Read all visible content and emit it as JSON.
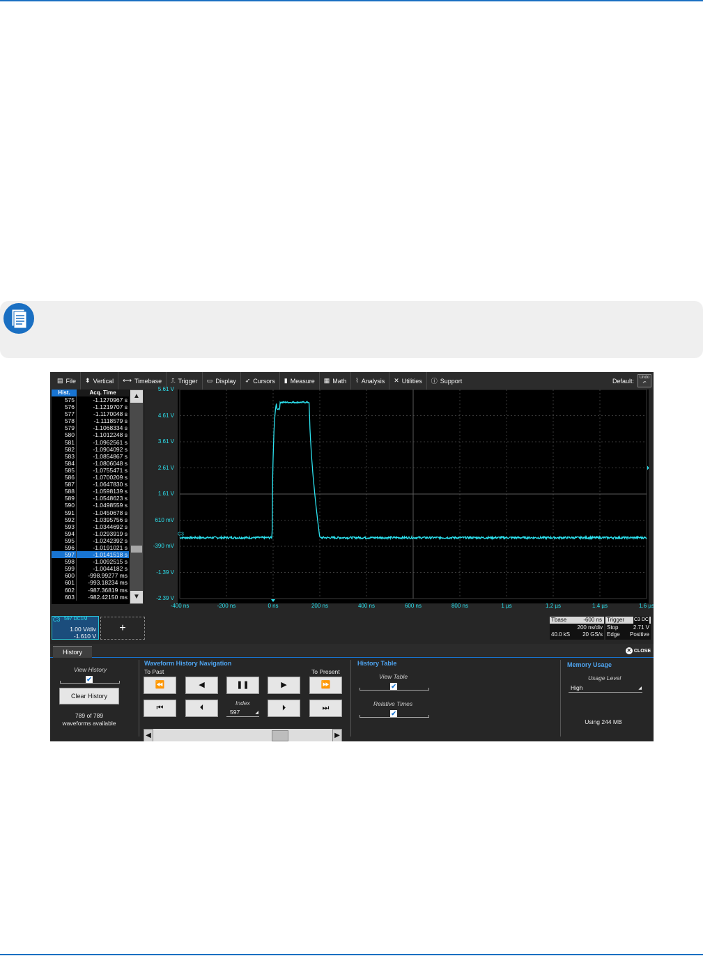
{
  "menu": {
    "items": [
      {
        "label": "File",
        "icon": "clipboard-icon"
      },
      {
        "label": "Vertical",
        "icon": "vertical-arrows-icon"
      },
      {
        "label": "Timebase",
        "icon": "horizontal-arrows-icon"
      },
      {
        "label": "Trigger",
        "icon": "trigger-icon"
      },
      {
        "label": "Display",
        "icon": "display-icon"
      },
      {
        "label": "Cursors",
        "icon": "cursor-icon"
      },
      {
        "label": "Measure",
        "icon": "ruler-icon"
      },
      {
        "label": "Math",
        "icon": "calculator-icon"
      },
      {
        "label": "Analysis",
        "icon": "chart-icon"
      },
      {
        "label": "Utilities",
        "icon": "tools-icon"
      },
      {
        "label": "Support",
        "icon": "info-icon"
      }
    ],
    "default_label": "Default:",
    "undo_label": "Undo"
  },
  "history_table": {
    "col_index": "Hist.",
    "col_time": "Acq. Time",
    "selected_index": "597",
    "rows": [
      {
        "idx": "575",
        "time": "-1.1270967 s"
      },
      {
        "idx": "576",
        "time": "-1.1219707 s"
      },
      {
        "idx": "577",
        "time": "-1.1170048 s"
      },
      {
        "idx": "578",
        "time": "-1.1118579 s"
      },
      {
        "idx": "579",
        "time": "-1.1068334 s"
      },
      {
        "idx": "580",
        "time": "-1.1012248 s"
      },
      {
        "idx": "581",
        "time": "-1.0962561 s"
      },
      {
        "idx": "582",
        "time": "-1.0904092 s"
      },
      {
        "idx": "583",
        "time": "-1.0854867 s"
      },
      {
        "idx": "584",
        "time": "-1.0806048 s"
      },
      {
        "idx": "585",
        "time": "-1.0755471 s"
      },
      {
        "idx": "586",
        "time": "-1.0700209 s"
      },
      {
        "idx": "587",
        "time": "-1.0647830 s"
      },
      {
        "idx": "588",
        "time": "-1.0598139 s"
      },
      {
        "idx": "589",
        "time": "-1.0548623 s"
      },
      {
        "idx": "590",
        "time": "-1.0498559 s"
      },
      {
        "idx": "591",
        "time": "-1.0450678 s"
      },
      {
        "idx": "592",
        "time": "-1.0395756 s"
      },
      {
        "idx": "593",
        "time": "-1.0344692 s"
      },
      {
        "idx": "594",
        "time": "-1.0293919 s"
      },
      {
        "idx": "595",
        "time": "-1.0242392 s"
      },
      {
        "idx": "596",
        "time": "-1.0191021 s"
      },
      {
        "idx": "597",
        "time": "-1.0141518 s"
      },
      {
        "idx": "598",
        "time": "-1.0092515 s"
      },
      {
        "idx": "599",
        "time": "-1.0044182 s"
      },
      {
        "idx": "600",
        "time": "-998.99277 ms"
      },
      {
        "idx": "601",
        "time": "-993.18234 ms"
      },
      {
        "idx": "602",
        "time": "-987.36819 ms"
      },
      {
        "idx": "603",
        "time": "-982.42150 ms"
      }
    ]
  },
  "channel": {
    "name": "C3",
    "badge": "597 DC1M",
    "vdiv": "1.00 V/div",
    "offset": "-1.610 V",
    "add_label": "+"
  },
  "scope": {
    "trace_color": "#2ce1ee",
    "trace_label": "C3",
    "y_labels": [
      "5.61 V",
      "4.61 V",
      "3.61 V",
      "2.61 V",
      "1.61 V",
      "610 mV",
      "-390 mV",
      "-1.39 V",
      "-2.39 V"
    ],
    "x_labels": [
      "-400 ns",
      "-200 ns",
      "0 ns",
      "200 ns",
      "400 ns",
      "600 ns",
      "800 ns",
      "1 µs",
      "1.2 µs",
      "1.4 µs",
      "1.6 µs"
    ],
    "waveform": {
      "baseline_v": -0.06,
      "high_v": 5.12,
      "rise_start_ns": -5,
      "fall_start_ns": 155,
      "fall_end_ns": 200,
      "t_min_ns": -400,
      "t_max_ns": 1600,
      "v_min": -2.39,
      "v_max": 5.61
    }
  },
  "timebase_box": {
    "title": "Tbase",
    "delay": "-600 ns",
    "tdiv": "200 ns/div",
    "samples": "40.0 kS",
    "rate": "20 GS/s"
  },
  "trigger_box": {
    "title": "Trigger",
    "badge": "C3 DC",
    "mode": "Stop",
    "level": "2.71 V",
    "type": "Edge",
    "slope": "Positive"
  },
  "panel": {
    "tab_label": "History",
    "close_label": "CLOSE",
    "view_history": {
      "label": "View History",
      "checked": true
    },
    "clear_button": "Clear History",
    "waveforms_available": "789 of 789",
    "waveforms_available_suffix": "waveforms available",
    "nav": {
      "title": "Waveform History Navigation",
      "to_past": "To Past",
      "to_present": "To Present",
      "index_label": "Index",
      "index_value": "597"
    },
    "table_section": {
      "title": "History Table",
      "view_table": "View Table",
      "relative_times": "Relative Times"
    },
    "memory": {
      "title": "Memory Usage",
      "usage_level_label": "Usage Level",
      "usage_level_value": "High",
      "using": "Using 244 MB"
    }
  },
  "colors": {
    "rule": "#1a6fc2",
    "accent_blue": "#1874d2",
    "section_title": "#4ea3ee"
  }
}
